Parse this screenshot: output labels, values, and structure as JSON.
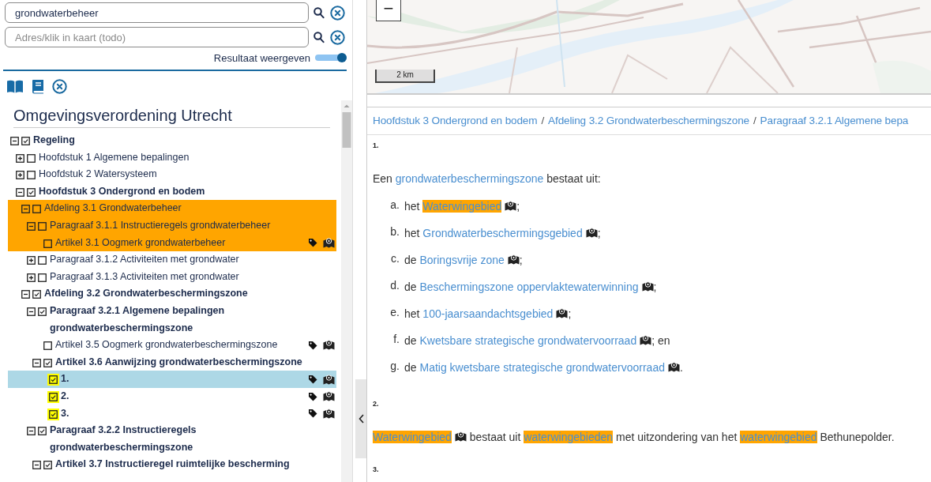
{
  "search": {
    "value": "grondwaterbeheer"
  },
  "address": {
    "placeholder": "Adres/klik in kaart (todo)"
  },
  "result_toggle": {
    "label": "Resultaat weergeven",
    "on": true
  },
  "document_title": "Omgevingsverordening Utrecht",
  "tree": [
    {
      "label": "Regeling",
      "checked": true,
      "expanded": true,
      "matched": false,
      "selected": false,
      "flagged": false,
      "children": [
        {
          "label": "Hoofdstuk 1 Algemene bepalingen",
          "checked": false,
          "expanded": false,
          "matched": false,
          "selected": false,
          "flagged": false
        },
        {
          "label": "Hoofdstuk 2 Watersysteem",
          "checked": false,
          "expanded": false,
          "matched": false,
          "selected": false,
          "flagged": false
        },
        {
          "label": "Hoofdstuk 3 Ondergrond en bodem",
          "checked": true,
          "expanded": true,
          "matched": false,
          "selected": false,
          "flagged": false,
          "children": [
            {
              "label": "Afdeling 3.1 Grondwaterbeheer",
              "checked": false,
              "expanded": true,
              "matched": true,
              "selected": false,
              "flagged": false,
              "children": [
                {
                  "label": "Paragraaf 3.1.1 Instructieregels grondwaterbeheer",
                  "checked": false,
                  "expanded": true,
                  "matched": true,
                  "selected": false,
                  "flagged": false,
                  "children": [
                    {
                      "label": "Artikel 3.1 Oogmerk grondwaterbeheer",
                      "checked": false,
                      "matched": true,
                      "selected": false,
                      "flagged": false
                    }
                  ]
                },
                {
                  "label": "Paragraaf 3.1.2 Activiteiten met grondwater",
                  "checked": false,
                  "expanded": false,
                  "matched": false,
                  "selected": false,
                  "flagged": false
                },
                {
                  "label": "Paragraaf 3.1.3 Activiteiten met grondwater",
                  "checked": false,
                  "expanded": false,
                  "matched": false,
                  "selected": false,
                  "flagged": false
                }
              ]
            },
            {
              "label": "Afdeling 3.2 Grondwaterbeschermingszone",
              "checked": true,
              "expanded": true,
              "matched": false,
              "selected": false,
              "flagged": false,
              "children": [
                {
                  "label": "Paragraaf 3.2.1 Algemene bepalingen grondwaterbeschermingszone",
                  "checked": true,
                  "expanded": true,
                  "matched": false,
                  "selected": false,
                  "flagged": false,
                  "children": [
                    {
                      "label": "Artikel 3.5 Oogmerk grondwaterbeschermingszone",
                      "checked": false,
                      "matched": false,
                      "selected": false,
                      "flagged": false
                    },
                    {
                      "label": "Artikel 3.6 Aanwijzing grondwaterbeschermingszone",
                      "checked": true,
                      "expanded": true,
                      "matched": false,
                      "selected": false,
                      "flagged": false,
                      "children": [
                        {
                          "label": "1.",
                          "checked": true,
                          "matched": false,
                          "selected": true,
                          "flagged": true
                        },
                        {
                          "label": "2.",
                          "checked": true,
                          "matched": false,
                          "selected": false,
                          "flagged": true
                        },
                        {
                          "label": "3.",
                          "checked": true,
                          "matched": false,
                          "selected": false,
                          "flagged": true
                        }
                      ]
                    }
                  ]
                },
                {
                  "label": "Paragraaf 3.2.2 Instructieregels grondwaterbeschermingszone",
                  "checked": true,
                  "expanded": true,
                  "matched": false,
                  "selected": false,
                  "flagged": false,
                  "children": [
                    {
                      "label": "Artikel 3.7 Instructieregel ruimtelijke bescherming",
                      "checked": true,
                      "expanded": true,
                      "matched": false,
                      "selected": false,
                      "flagged": false
                    }
                  ]
                }
              ]
            }
          ]
        }
      ]
    }
  ],
  "map": {
    "zoom_out": "−",
    "scale": "2 km"
  },
  "breadcrumb": [
    {
      "kind": "link",
      "text": "Hoofdstuk 3 Ondergrond en bodem"
    },
    {
      "kind": "separator",
      "text": "/"
    },
    {
      "kind": "link",
      "text": "Afdeling 3.2 Grondwaterbeschermingszone"
    },
    {
      "kind": "separator",
      "text": "/"
    },
    {
      "kind": "link",
      "text": "Paragraaf 3.2.1 Algemene bepa"
    }
  ],
  "article": [
    {
      "number": "1.",
      "intro": [
        {
          "kind": "plain",
          "text": "Een "
        },
        {
          "kind": "link",
          "text": "grondwaterbeschermingszone",
          "highlighted": false,
          "map": false
        },
        {
          "kind": "plain",
          "text": " bestaat uit:"
        }
      ],
      "items": [
        {
          "marker": "a.",
          "segments": [
            {
              "kind": "plain",
              "text": "het "
            },
            {
              "kind": "link",
              "text": "Waterwingebied",
              "highlighted": true,
              "map": true
            },
            {
              "kind": "plain",
              "text": ";"
            }
          ]
        },
        {
          "marker": "b.",
          "segments": [
            {
              "kind": "plain",
              "text": "het "
            },
            {
              "kind": "link",
              "text": "Grondwaterbeschermingsgebied",
              "highlighted": false,
              "map": true
            },
            {
              "kind": "plain",
              "text": ";"
            }
          ]
        },
        {
          "marker": "c.",
          "segments": [
            {
              "kind": "plain",
              "text": "de "
            },
            {
              "kind": "link",
              "text": "Boringsvrije zone",
              "highlighted": false,
              "map": true
            },
            {
              "kind": "plain",
              "text": ";"
            }
          ]
        },
        {
          "marker": "d.",
          "segments": [
            {
              "kind": "plain",
              "text": "de "
            },
            {
              "kind": "link",
              "text": "Beschermingszone oppervlaktewaterwinning",
              "highlighted": false,
              "map": true
            },
            {
              "kind": "plain",
              "text": ";"
            }
          ]
        },
        {
          "marker": "e.",
          "segments": [
            {
              "kind": "plain",
              "text": "het "
            },
            {
              "kind": "link",
              "text": "100-jaarsaandachtsgebied",
              "highlighted": false,
              "map": true
            },
            {
              "kind": "plain",
              "text": ";"
            }
          ]
        },
        {
          "marker": "f.",
          "segments": [
            {
              "kind": "plain",
              "text": "de "
            },
            {
              "kind": "link",
              "text": "Kwetsbare strategische grondwatervoorraad",
              "highlighted": false,
              "map": true
            },
            {
              "kind": "plain",
              "text": "; en"
            }
          ]
        },
        {
          "marker": "g.",
          "segments": [
            {
              "kind": "plain",
              "text": "de "
            },
            {
              "kind": "link",
              "text": "Matig kwetsbare strategische grondwatervoorraad",
              "highlighted": false,
              "map": true
            },
            {
              "kind": "plain",
              "text": "."
            }
          ]
        }
      ]
    },
    {
      "number": "2.",
      "intro": [
        {
          "kind": "link",
          "text": "Waterwingebied",
          "highlighted": true,
          "map": true
        },
        {
          "kind": "plain",
          "text": " bestaat uit "
        },
        {
          "kind": "link",
          "text": "waterwingebieden",
          "highlighted": true,
          "map": false
        },
        {
          "kind": "plain",
          "text": " met uitzondering van het "
        },
        {
          "kind": "link",
          "text": "waterwingebied",
          "highlighted": true,
          "map": false
        },
        {
          "kind": "plain",
          "text": " Bethunepolder."
        }
      ]
    },
    {
      "number": "3."
    }
  ]
}
